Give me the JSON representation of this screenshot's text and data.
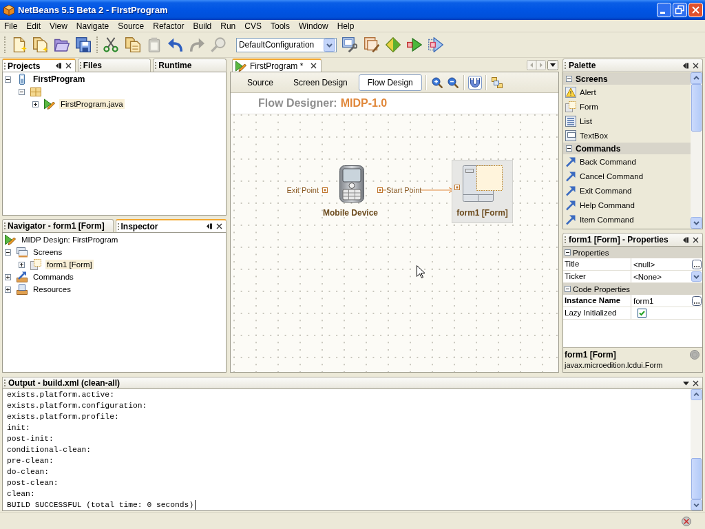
{
  "window": {
    "title": "NetBeans 5.5 Beta 2 - FirstProgram"
  },
  "menu_bar": [
    "File",
    "Edit",
    "View",
    "Navigate",
    "Source",
    "Refactor",
    "Build",
    "Run",
    "CVS",
    "Tools",
    "Window",
    "Help"
  ],
  "toolbar": {
    "groups": [
      [
        {
          "kind": "new-file",
          "disabled": false
        },
        {
          "kind": "new-project",
          "disabled": false
        },
        {
          "kind": "open-project",
          "disabled": false
        },
        {
          "kind": "save-all",
          "disabled": false
        }
      ],
      [
        {
          "kind": "cut",
          "disabled": false
        },
        {
          "kind": "copy",
          "disabled": false
        },
        {
          "kind": "paste",
          "disabled": true
        },
        {
          "kind": "undo",
          "disabled": false
        },
        {
          "kind": "redo",
          "disabled": true
        },
        {
          "kind": "find",
          "disabled": true
        }
      ]
    ],
    "configuration": "DefaultConfiguration",
    "actions": [
      {
        "kind": "configure",
        "disabled": false
      },
      {
        "kind": "compile",
        "disabled": false
      },
      {
        "kind": "build",
        "disabled": false
      },
      {
        "kind": "run",
        "disabled": false
      },
      {
        "kind": "deploy",
        "disabled": false
      }
    ]
  },
  "projects_panel": {
    "tabs": [
      {
        "label": "Projects",
        "selected": true
      },
      {
        "label": "Files",
        "selected": false
      },
      {
        "label": "Runtime",
        "selected": false
      }
    ],
    "tree": [
      {
        "label": "FirstProgram",
        "kind": "project",
        "expanded": true,
        "selected": false,
        "children": [
          {
            "kind": "package",
            "expanded": true,
            "selected": false,
            "children": [
              {
                "label": "FirstProgram.java",
                "kind": "midlet",
                "expanded": false,
                "selected": true
              }
            ]
          }
        ]
      }
    ]
  },
  "inspector_panel": {
    "tabs": [
      {
        "label": "Navigator - form1 [Form]",
        "selected": false
      },
      {
        "label": "Inspector",
        "selected": true
      }
    ],
    "tree": [
      {
        "label": "MIDP Design: FirstProgram",
        "kind": "design",
        "selected": false,
        "children": [
          {
            "label": "Screens",
            "kind": "screens",
            "expanded": true,
            "selected": false,
            "children": [
              {
                "label": "form1 [Form]",
                "kind": "form",
                "expanded": false,
                "selected": true
              }
            ]
          },
          {
            "label": "Commands",
            "kind": "commands",
            "expanded": false,
            "selected": false
          },
          {
            "label": "Resources",
            "kind": "resources",
            "expanded": false,
            "selected": false
          }
        ]
      }
    ]
  },
  "editor": {
    "tabs": [
      {
        "label": "FirstProgram *",
        "selected": true
      }
    ],
    "views": [
      {
        "label": "Source",
        "selected": false
      },
      {
        "label": "Screen Design",
        "selected": false
      },
      {
        "label": "Flow Design",
        "selected": true
      }
    ],
    "tools": [
      [
        {
          "kind": "zoom-in",
          "on": false
        },
        {
          "kind": "zoom-out",
          "on": false
        }
      ],
      [
        {
          "kind": "snap",
          "on": true
        }
      ],
      [
        {
          "kind": "layout",
          "on": false
        }
      ]
    ],
    "heading": {
      "label": "Flow Designer:",
      "profile": "MIDP-1.0"
    },
    "flow": {
      "nodes": [
        {
          "kind": "device",
          "label": "Mobile Device",
          "selected": false,
          "ports": [
            {
              "label": "Exit Point",
              "kind": "exit",
              "connected": false
            },
            {
              "label": "Start Point",
              "kind": "start",
              "connected": true
            }
          ]
        },
        {
          "kind": "form",
          "label": "form1 [Form]",
          "selected": true
        }
      ]
    }
  },
  "palette": {
    "title": "Palette",
    "categories": [
      {
        "label": "Screens",
        "expanded": true,
        "items": [
          {
            "label": "Alert",
            "kind": "alert"
          },
          {
            "label": "Form",
            "kind": "form"
          },
          {
            "label": "List",
            "kind": "list"
          },
          {
            "label": "TextBox",
            "kind": "textbox"
          }
        ]
      },
      {
        "label": "Commands",
        "expanded": true,
        "items": [
          {
            "label": "Back Command",
            "kind": "command"
          },
          {
            "label": "Cancel Command",
            "kind": "command"
          },
          {
            "label": "Exit Command",
            "kind": "command"
          },
          {
            "label": "Help Command",
            "kind": "command"
          },
          {
            "label": "Item Command",
            "kind": "command"
          }
        ]
      }
    ]
  },
  "properties": {
    "title": "form1 [Form] - Properties",
    "sections": [
      {
        "label": "Properties",
        "expanded": true,
        "rows": [
          {
            "name": "Title",
            "value": "<null>",
            "kind": "custom",
            "modified": false
          },
          {
            "name": "Ticker",
            "value": "<None>",
            "kind": "combo",
            "modified": false
          }
        ]
      },
      {
        "label": "Code Properties",
        "expanded": true,
        "rows": [
          {
            "name": "Instance Name",
            "value": "form1",
            "kind": "custom",
            "modified": true
          },
          {
            "name": "Lazy Initialized",
            "kind": "checkbox",
            "checked": true,
            "modified": false
          }
        ]
      }
    ],
    "description": {
      "title": "form1 [Form]",
      "text": "javax.microedition.lcdui.Form"
    }
  },
  "output": {
    "title": "Output - build.xml (clean-all)",
    "lines": [
      "exists.platform.active:",
      "exists.platform.configuration:",
      "exists.platform.profile:",
      "init:",
      "post-init:",
      "conditional-clean:",
      "pre-clean:",
      "do-clean:",
      "post-clean:",
      "clean:",
      "BUILD SUCCESSFUL (total time: 0 seconds)"
    ]
  }
}
